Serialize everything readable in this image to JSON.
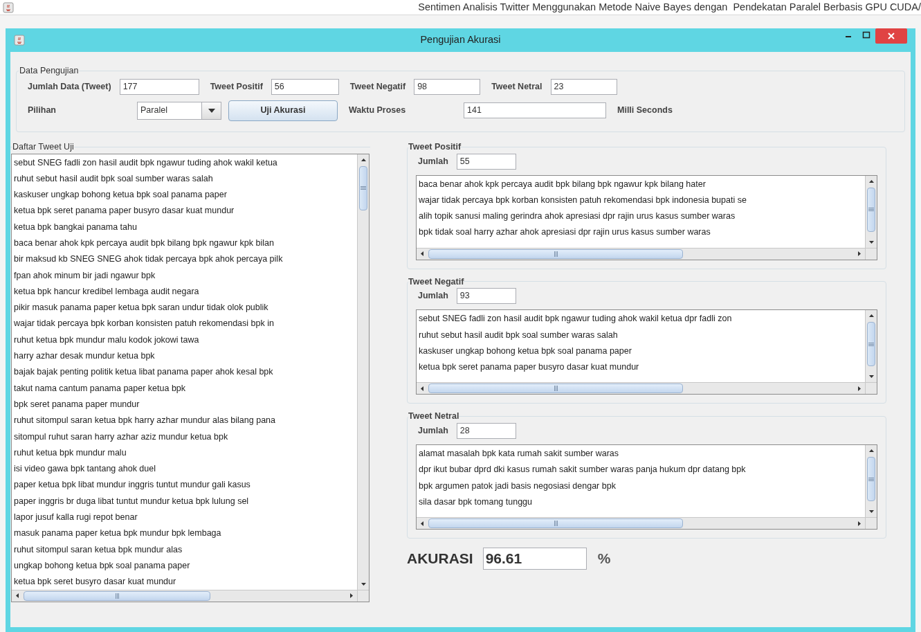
{
  "app_title": "Sentimen Analisis Twitter Menggunakan Metode Naive Bayes dengan  Pendekatan Paralel Berbasis GPU CUDA/",
  "dialog": {
    "title": "Pengujian Akurasi"
  },
  "data_pengujian": {
    "title": "Data Pengujian",
    "fields": [
      {
        "label": "Jumlah Data (Tweet)",
        "value": "177"
      },
      {
        "label": "Tweet Positif",
        "value": "56"
      },
      {
        "label": "Tweet Negatif",
        "value": "98"
      },
      {
        "label": "Tweet Netral",
        "value": "23"
      }
    ],
    "pilihan": {
      "label": "Pilihan",
      "value": "Paralel"
    },
    "button": "Uji Akurasi",
    "waktu": {
      "label": "Waktu Proses",
      "value": "141",
      "unit": "Milli Seconds"
    }
  },
  "daftar": {
    "title": "Daftar Tweet Uji",
    "items": [
      "sebut SNEG fadli zon hasil audit bpk ngawur tuding ahok wakil ketua",
      "ruhut sebut hasil audit bpk soal sumber waras salah",
      "kaskuser ungkap bohong ketua bpk soal panama paper",
      "ketua bpk seret panama paper busyro dasar kuat mundur",
      "ketua bpk bangkai panama tahu",
      "baca benar ahok kpk percaya audit bpk bilang bpk ngawur kpk bilan",
      "bir maksud kb SNEG SNEG ahok tidak percaya bpk ahok percaya pilk",
      "fpan ahok minum bir jadi ngawur bpk",
      "ketua bpk hancur kredibel lembaga audit negara",
      "pikir masuk panama paper ketua bpk saran undur tidak olok publik",
      "wajar tidak percaya bpk korban konsisten patuh rekomendasi bpk in",
      "ruhut ketua bpk mundur malu kodok jokowi tawa",
      "harry azhar desak mundur ketua bpk",
      "bajak bajak penting politik ketua libat panama paper ahok kesal bpk",
      "takut nama cantum panama paper ketua bpk",
      "bpk seret panama paper mundur",
      "ruhut sitompul saran ketua bpk harry azhar mundur alas bilang pana",
      "sitompul ruhut saran harry azhar aziz mundur ketua bpk",
      "ruhut ketua bpk mundur malu",
      "isi video gawa bpk tantang ahok duel",
      "paper ketua bpk libat mundur inggris tuntut mundur gali kasus",
      "paper inggris br duga libat tuntut mundur ketua bpk lulung sel",
      "lapor jusuf kalla rugi repot benar",
      "masuk panama paper ketua bpk mundur bpk lembaga",
      "ruhut sitompul saran ketua bpk mundur alas",
      "ungkap bohong ketua bpk soal panama paper",
      "ketua bpk seret busyro dasar kuat mundur"
    ]
  },
  "groups": [
    {
      "title": "Tweet Positif",
      "jumlah_label": "Jumlah",
      "jumlah": "55",
      "items": [
        "baca benar ahok kpk percaya audit bpk bilang bpk ngawur kpk bilang hater",
        "wajar tidak percaya bpk korban konsisten patuh rekomendasi bpk indonesia bupati se",
        "alih topik sanusi maling gerindra ahok apresiasi dpr rajin urus kasus sumber waras",
        "bpk tidak soal harry azhar ahok apresiasi dpr rajin urus kasus sumber waras"
      ]
    },
    {
      "title": "Tweet Negatif",
      "jumlah_label": "Jumlah",
      "jumlah": "93",
      "items": [
        "sebut SNEG fadli zon hasil audit bpk ngawur tuding ahok wakil ketua dpr fadli zon",
        "ruhut sebut hasil audit bpk soal sumber waras salah",
        "kaskuser ungkap bohong ketua bpk soal panama paper",
        "ketua bpk seret panama paper busyro dasar kuat mundur"
      ]
    },
    {
      "title": "Tweet Netral",
      "jumlah_label": "Jumlah",
      "jumlah": "28",
      "items": [
        "alamat masalah bpk kata rumah sakit sumber waras",
        "dpr ikut bubar dprd dki kasus rumah sakit sumber waras panja hukum dpr datang bpk",
        "bpk argumen patok jadi basis negosiasi dengar bpk",
        "sila dasar bpk tomang tunggu"
      ]
    }
  ],
  "akurasi": {
    "label": "AKURASI",
    "value": "96.61",
    "unit": "%"
  }
}
